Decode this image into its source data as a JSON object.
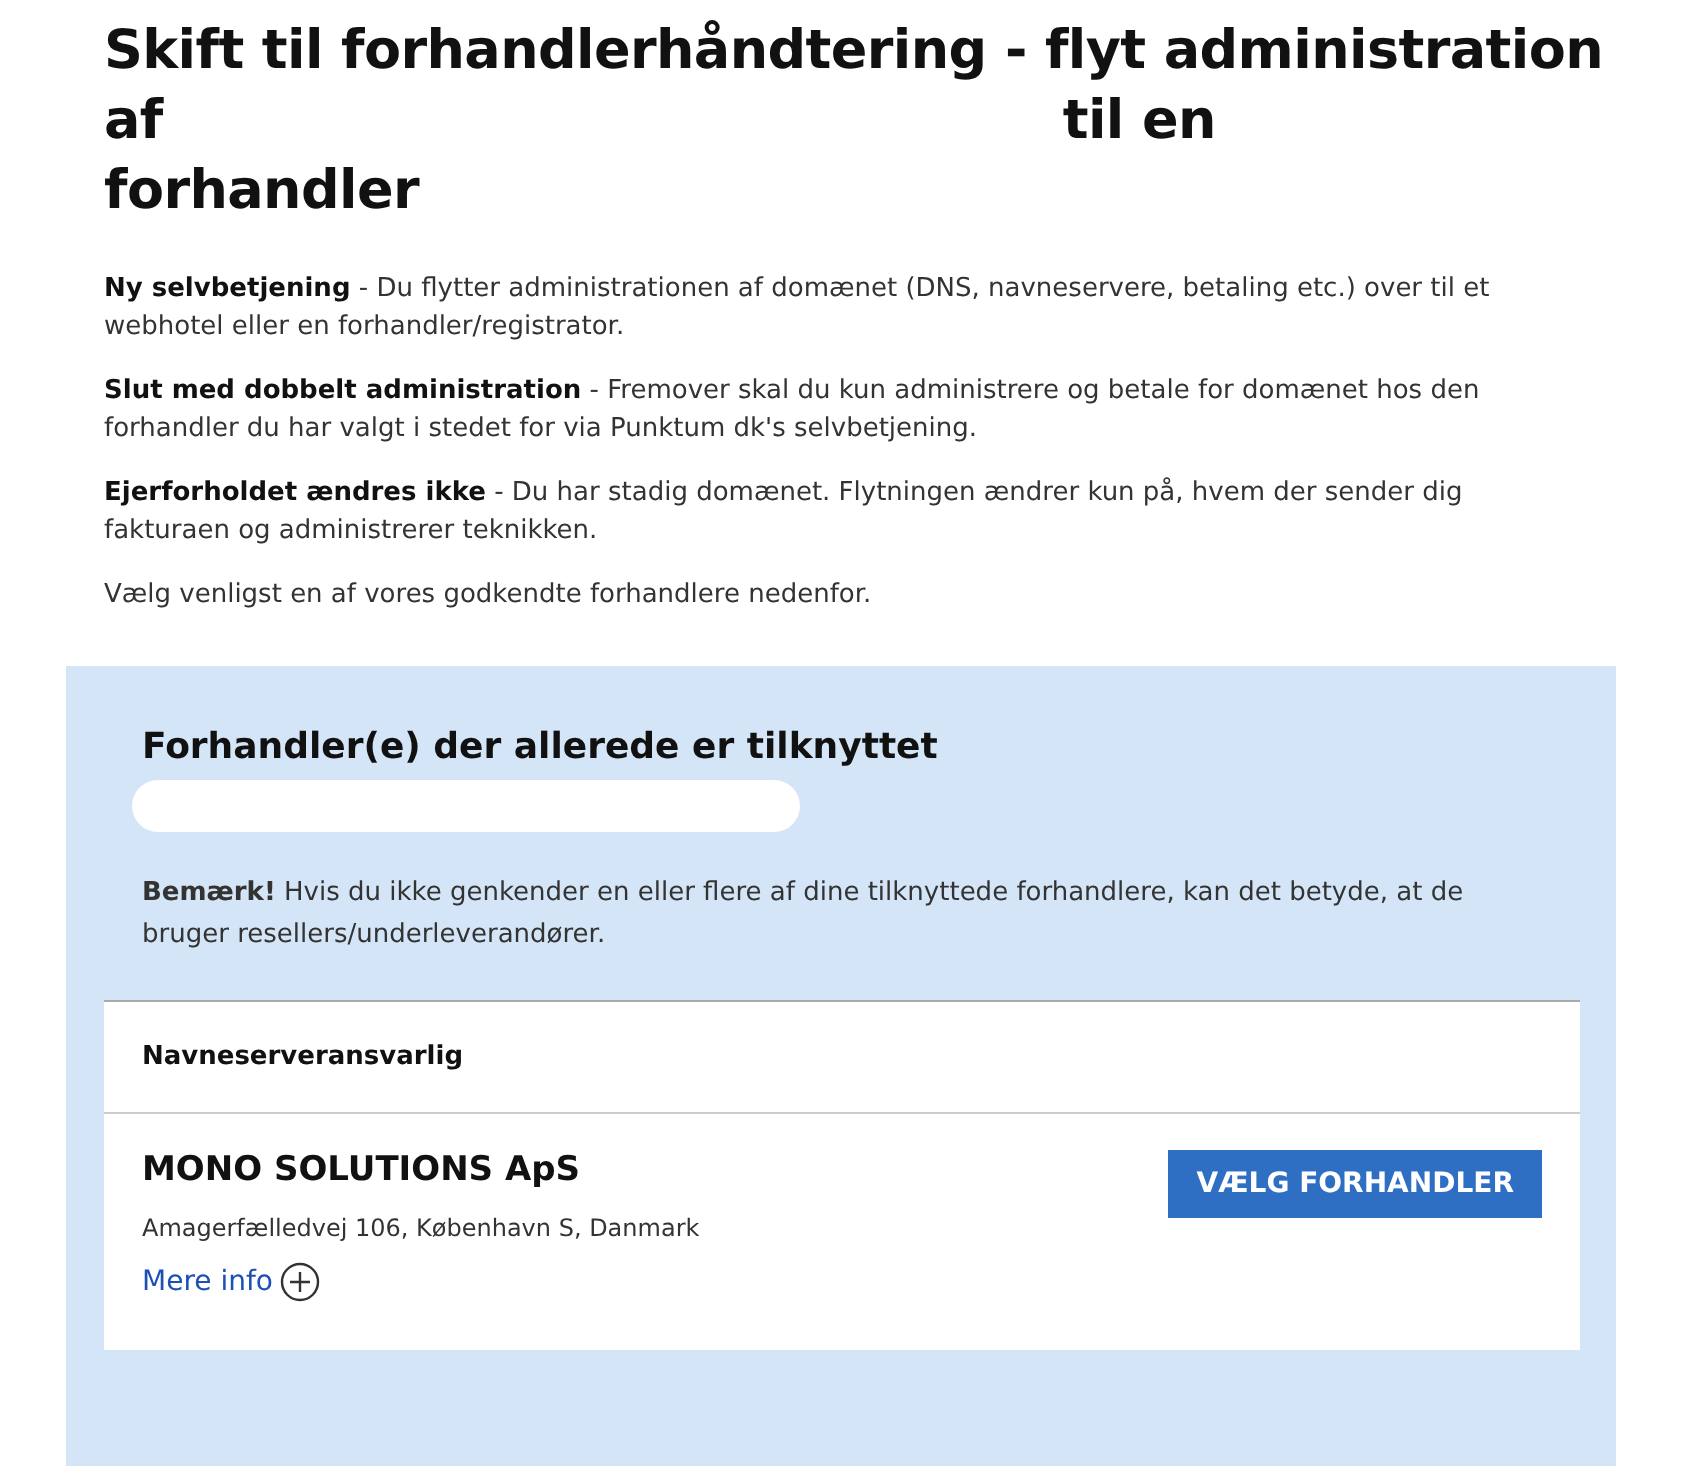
{
  "title": {
    "lines": [
      [
        "Skift til forhandlerhåndtering - flyt administration"
      ],
      [
        "af",
        "til en"
      ],
      [
        "forhandler"
      ]
    ]
  },
  "intro": [
    {
      "lead": "Ny selvbetjening",
      "text": " - Du flytter administrationen af domænet (DNS, navneservere, betaling etc.) over til et webhotel eller en forhandler/registrator."
    },
    {
      "lead": "Slut med dobbelt administration",
      "text": " - Fremover skal du kun administrere og betale for domænet hos den forhandler du har valgt i stedet for via Punktum dk's selvbetjening."
    },
    {
      "lead": "Ejerforholdet ændres ikke",
      "text": " - Du har stadig domænet. Flytningen ændrer kun på, hvem der sender dig fakturaen og administrerer teknikken."
    },
    {
      "text": "Vælg venligst en af vores godkendte forhandlere nedenfor."
    }
  ],
  "panel": {
    "heading": "Forhandler(e) der allerede er tilknyttet",
    "note": "**Bemærk!** Hvis du ikke genkender en eller flere af dine tilknyttede forhandlere, kan det betyde, at de bruger resellers/underleverandører.",
    "card": {
      "role": "Navneserveransvarlig",
      "name": "MONO SOLUTIONS ApS",
      "address": "Amagerfælledvej 106, København S, Danmark",
      "link": "Mere info",
      "button": "VÆLG FORHANDLER"
    }
  }
}
